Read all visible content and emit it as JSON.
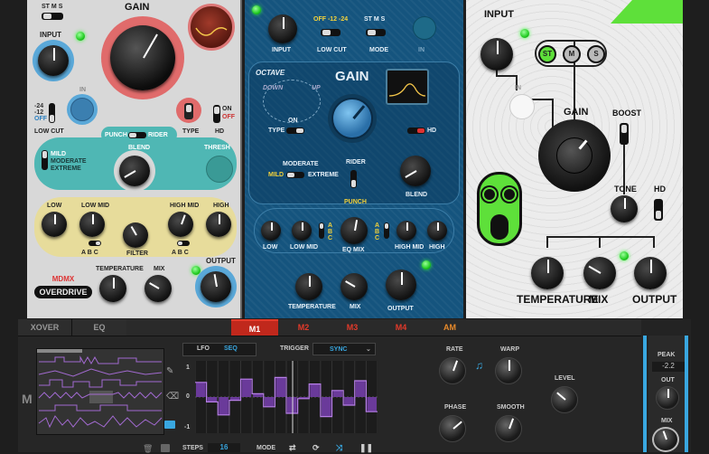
{
  "p1": {
    "stereo": {
      "st": "ST",
      "m": "M",
      "s": "S"
    },
    "gain": "GAIN",
    "input": "INPUT",
    "in": "IN",
    "low_cut_opts": {
      "a": "-24",
      "b": "-12",
      "c": "OFF"
    },
    "low_cut": "LOW CUT",
    "type": "TYPE",
    "hd_opts": {
      "on": "ON",
      "off": "OFF"
    },
    "hd": "HD",
    "punch": "PUNCH",
    "rider": "RIDER",
    "blend": "BLEND",
    "thresh": "THRESH",
    "mild": "MILD",
    "moderate": "MODERATE",
    "extreme": "EXTREME",
    "low": "LOW",
    "low_mid": "LOW MID",
    "high_mid": "HIGH MID",
    "high": "HIGH",
    "filter": "FILTER",
    "ab": "A B C",
    "brand1": "MDMX",
    "brand2": "OVERDRIVE",
    "temperature": "TEMPERATURE",
    "mix": "MIX",
    "output": "OUTPUT"
  },
  "p2": {
    "input": "INPUT",
    "lowcut_opts": "OFF -12 -24",
    "low_cut": "LOW CUT",
    "mode_opts": "ST M S",
    "mode": "MODE",
    "in": "IN",
    "octave": "OCTAVE",
    "down": "DOWN",
    "up": "UP",
    "on": "ON",
    "gain": "GAIN",
    "type": "TYPE",
    "hd": "HD",
    "moderate": "MODERATE",
    "mild": "MILD",
    "extreme": "EXTREME",
    "rider": "RIDER",
    "punch": "PUNCH",
    "blend": "BLEND",
    "low": "LOW",
    "low_mid": "LOW MID",
    "abc": "A B C",
    "eq_mix": "EQ MIX",
    "high_mid": "HIGH MID",
    "high": "HIGH",
    "temperature": "TEMPERATURE",
    "mix": "MIX",
    "output": "OUTPUT"
  },
  "p3": {
    "input": "INPUT",
    "st": "ST",
    "m": "M",
    "s": "S",
    "in": "IN",
    "gain": "GAIN",
    "boost": "BOOST",
    "tone": "TONE",
    "hd": "HD",
    "temperature": "TEMPERATURE",
    "mix": "MIX",
    "output": "OUTPUT"
  },
  "bottom": {
    "tabs": [
      "XOVER",
      "EQ"
    ],
    "mtabs": [
      "M1",
      "M2",
      "M3",
      "M4",
      "AM"
    ],
    "lfo": "LFO",
    "seq": "SEQ",
    "trigger": "TRIGGER",
    "sync": "SYNC",
    "y_top": "1",
    "y_mid": "0",
    "y_bot": "-1",
    "steps": "STEPS",
    "steps_val": "16",
    "mode": "MODE",
    "rate": "RATE",
    "warp": "WARP",
    "level": "LEVEL",
    "phase": "PHASE",
    "smooth": "SMOOTH",
    "peak": "PEAK",
    "peak_val": "-2.2",
    "out": "OUT",
    "mix": "MIX",
    "m": "M"
  },
  "seq_values": [
    0.45,
    -0.15,
    -0.55,
    -0.1,
    0.55,
    0.1,
    -0.3,
    0.6,
    -0.5,
    -0.05,
    0.4,
    -0.6,
    0.2,
    -0.25,
    0.5,
    -0.45
  ]
}
